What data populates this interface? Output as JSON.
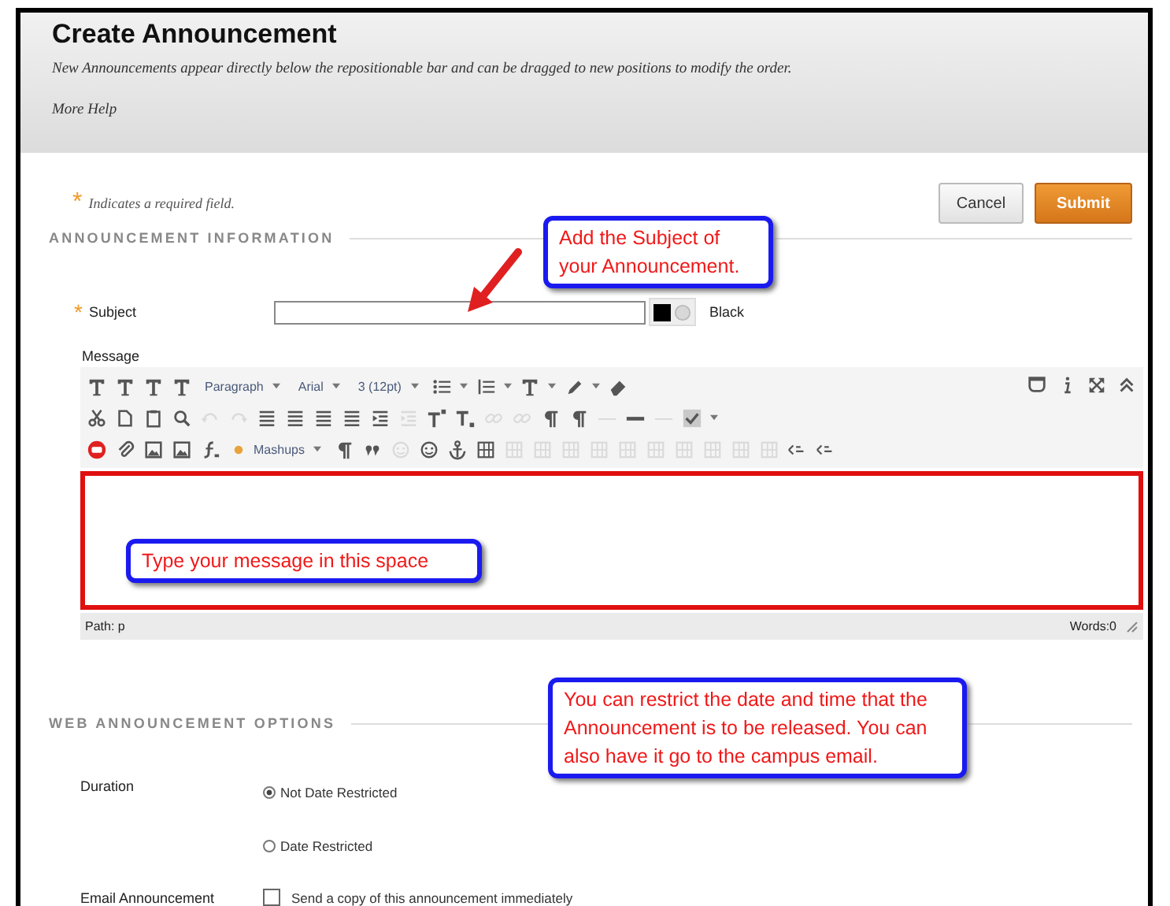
{
  "header": {
    "title": "Create Announcement",
    "description": "New Announcements appear directly below the repositionable bar and can be dragged to new positions to modify the order.",
    "help_link": "More Help"
  },
  "required_note": {
    "marker": "*",
    "text": "Indicates a required field."
  },
  "buttons": [
    {
      "label": "Cancel",
      "kind": "secondary"
    },
    {
      "label": "Submit",
      "kind": "primary"
    }
  ],
  "sections": [
    {
      "title": "ANNOUNCEMENT INFORMATION"
    },
    {
      "title": "WEB ANNOUNCEMENT OPTIONS"
    }
  ],
  "subject": {
    "marker": "*",
    "label": "Subject",
    "color_name": "Black",
    "color": "#000000"
  },
  "message": {
    "label": "Message",
    "toolbar_rows": [
      [
        {
          "kind": "icon",
          "disabled": false
        },
        {
          "kind": "icon",
          "disabled": false
        },
        {
          "kind": "icon",
          "disabled": false
        },
        {
          "kind": "icon",
          "disabled": false
        },
        {
          "kind": "select",
          "label": "Paragraph"
        },
        {
          "kind": "select",
          "label": "Arial"
        },
        {
          "kind": "select",
          "label": "3 (12pt)"
        },
        {
          "kind": "split",
          "disabled": false
        },
        {
          "kind": "split",
          "disabled": false
        },
        {
          "kind": "split",
          "disabled": false
        },
        {
          "kind": "split",
          "disabled": false
        },
        {
          "kind": "icon",
          "disabled": false
        }
      ],
      [
        {
          "kind": "icon",
          "disabled": false
        },
        {
          "kind": "icon",
          "disabled": false
        },
        {
          "kind": "icon",
          "disabled": false
        },
        {
          "kind": "icon",
          "disabled": false
        },
        {
          "kind": "icon",
          "disabled": true
        },
        {
          "kind": "icon",
          "disabled": true
        },
        {
          "kind": "icon",
          "disabled": false
        },
        {
          "kind": "icon",
          "disabled": false
        },
        {
          "kind": "icon",
          "disabled": false
        },
        {
          "kind": "icon",
          "disabled": false
        },
        {
          "kind": "icon",
          "disabled": false
        },
        {
          "kind": "icon",
          "disabled": true
        },
        {
          "kind": "icon",
          "disabled": false
        },
        {
          "kind": "icon",
          "disabled": false
        },
        {
          "kind": "icon",
          "disabled": true
        },
        {
          "kind": "icon",
          "disabled": true
        },
        {
          "kind": "icon",
          "disabled": false
        },
        {
          "kind": "icon",
          "disabled": false
        },
        {
          "kind": "icon",
          "disabled": true
        },
        {
          "kind": "icon",
          "disabled": false
        },
        {
          "kind": "icon",
          "disabled": true
        },
        {
          "kind": "split",
          "disabled": false
        }
      ],
      [
        {
          "kind": "icon",
          "disabled": false
        },
        {
          "kind": "icon",
          "disabled": false
        },
        {
          "kind": "icon",
          "disabled": false
        },
        {
          "kind": "icon",
          "disabled": false
        },
        {
          "kind": "icon",
          "disabled": false
        },
        {
          "kind": "select",
          "label": "Mashups"
        },
        {
          "kind": "icon",
          "disabled": false
        },
        {
          "kind": "icon",
          "disabled": false
        },
        {
          "kind": "icon",
          "disabled": true
        },
        {
          "kind": "icon",
          "disabled": false
        },
        {
          "kind": "icon",
          "disabled": false
        },
        {
          "kind": "icon",
          "disabled": false
        },
        {
          "kind": "icon",
          "disabled": true
        },
        {
          "kind": "icon",
          "disabled": true
        },
        {
          "kind": "icon",
          "disabled": true
        },
        {
          "kind": "icon",
          "disabled": true
        },
        {
          "kind": "icon",
          "disabled": true
        },
        {
          "kind": "icon",
          "disabled": true
        },
        {
          "kind": "icon",
          "disabled": true
        },
        {
          "kind": "icon",
          "disabled": true
        },
        {
          "kind": "icon",
          "disabled": true
        },
        {
          "kind": "icon",
          "disabled": true
        },
        {
          "kind": "icon",
          "disabled": false
        },
        {
          "kind": "icon",
          "disabled": false
        }
      ]
    ],
    "toolbar_right": [
      {
        "kind": "icon",
        "disabled": false
      },
      {
        "kind": "icon",
        "disabled": false
      },
      {
        "kind": "icon",
        "disabled": false
      },
      {
        "kind": "icon",
        "disabled": false
      }
    ],
    "path": "Path: p",
    "word_count": "Words:0"
  },
  "duration": {
    "label": "Duration",
    "options": [
      {
        "label": "Not Date Restricted",
        "selected": true
      },
      {
        "label": "Date Restricted",
        "selected": false
      }
    ]
  },
  "email": {
    "label": "Email Announcement",
    "option": "Send a copy of this announcement immediately",
    "checked": false
  },
  "callouts": [
    {
      "kind": "subject",
      "text": "Add the Subject of your Announcement."
    },
    {
      "kind": "message",
      "text": "Type your message in this space"
    },
    {
      "kind": "options",
      "text": "You can restrict the date and time that the Announcement is to be released.  You can also have it go to the campus email."
    }
  ]
}
